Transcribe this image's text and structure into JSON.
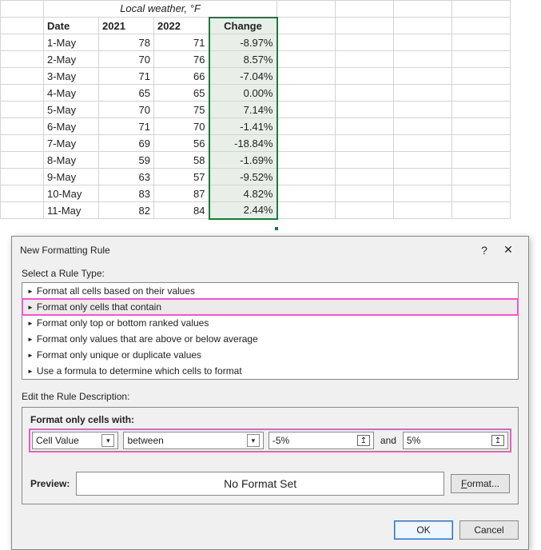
{
  "sheet": {
    "title": "Local weather, °F",
    "headers": {
      "date": "Date",
      "y1": "2021",
      "y2": "2022",
      "change": "Change"
    },
    "rows": [
      {
        "date": "1-May",
        "y1": "78",
        "y2": "71",
        "change": "-8.97%"
      },
      {
        "date": "2-May",
        "y1": "70",
        "y2": "76",
        "change": "8.57%"
      },
      {
        "date": "3-May",
        "y1": "71",
        "y2": "66",
        "change": "-7.04%"
      },
      {
        "date": "4-May",
        "y1": "65",
        "y2": "65",
        "change": "0.00%"
      },
      {
        "date": "5-May",
        "y1": "70",
        "y2": "75",
        "change": "7.14%"
      },
      {
        "date": "6-May",
        "y1": "71",
        "y2": "70",
        "change": "-1.41%"
      },
      {
        "date": "7-May",
        "y1": "69",
        "y2": "56",
        "change": "-18.84%"
      },
      {
        "date": "8-May",
        "y1": "59",
        "y2": "58",
        "change": "-1.69%"
      },
      {
        "date": "9-May",
        "y1": "63",
        "y2": "57",
        "change": "-9.52%"
      },
      {
        "date": "10-May",
        "y1": "83",
        "y2": "87",
        "change": "4.82%"
      },
      {
        "date": "11-May",
        "y1": "82",
        "y2": "84",
        "change": "2.44%"
      }
    ]
  },
  "dialog": {
    "title": "New Formatting Rule",
    "help": "?",
    "close": "✕",
    "select_label": "Select a Rule Type:",
    "rules": [
      "Format all cells based on their values",
      "Format only cells that contain",
      "Format only top or bottom ranked values",
      "Format only values that are above or below average",
      "Format only unique or duplicate values",
      "Use a formula to determine which cells to format"
    ],
    "selected_rule_index": 1,
    "edit_label": "Edit the Rule Description:",
    "cells_with": "Format only cells with:",
    "combo1": "Cell Value",
    "combo2": "between",
    "val1": "-5%",
    "and": "and",
    "val2": "5%",
    "preview_label": "Preview:",
    "preview_text": "No Format Set",
    "format_btn": "Format...",
    "ok": "OK",
    "cancel": "Cancel"
  }
}
